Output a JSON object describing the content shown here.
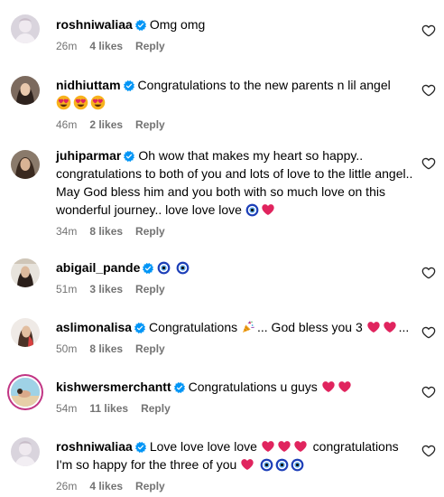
{
  "colors": {
    "verified": "#0095f6",
    "meta_text": "#737373",
    "heart": "#e0245e",
    "evil_eye": "#1d3fb8"
  },
  "comments": [
    {
      "username": "roshniwaliaa",
      "text": "Omg omg",
      "time": "26m",
      "likes": "4 likes",
      "reply": "Reply",
      "emojis_after": []
    },
    {
      "username": "nidhiuttam",
      "text": "Congratulations to the new parents n lil angel",
      "time": "46m",
      "likes": "2 likes",
      "reply": "Reply",
      "emojis_after": [
        "heart-eyes",
        "heart-eyes",
        "heart-eyes"
      ]
    },
    {
      "username": "juhiparmar",
      "text": "Oh wow that makes my heart so happy.. congratulations to both of you and lots of love to the little angel.. May God bless him and you both with so much love on this wonderful journey.. love love love",
      "time": "34m",
      "likes": "8 likes",
      "reply": "Reply",
      "emojis_after": [
        "evil-eye",
        "red-heart"
      ]
    },
    {
      "username": "abigail_pande",
      "text": "",
      "time": "51m",
      "likes": "3 likes",
      "reply": "Reply",
      "emojis_after": [
        "evil-eye",
        "evil-eye"
      ]
    },
    {
      "username": "aslimonalisa",
      "text": "Congratulations",
      "text_after_emoji": "... God bless you 3",
      "trailing": "...",
      "time": "50m",
      "likes": "8 likes",
      "reply": "Reply",
      "emojis_after": [
        "party-popper",
        "red-heart",
        "red-heart"
      ]
    },
    {
      "username": "kishwersmerchantt",
      "text": "Congratulations u guys",
      "time": "54m",
      "likes": "11 likes",
      "reply": "Reply",
      "emojis_after": [
        "red-heart",
        "red-heart"
      ]
    },
    {
      "username": "roshniwaliaa",
      "text": "Love love love love",
      "text_after_emoji": "congratulations I'm so happy for the three of you",
      "time": "26m",
      "likes": "4 likes",
      "reply": "Reply",
      "emojis_after": [
        "red-heart",
        "red-heart",
        "red-heart",
        "red-heart",
        "evil-eye",
        "evil-eye",
        "evil-eye"
      ]
    }
  ]
}
